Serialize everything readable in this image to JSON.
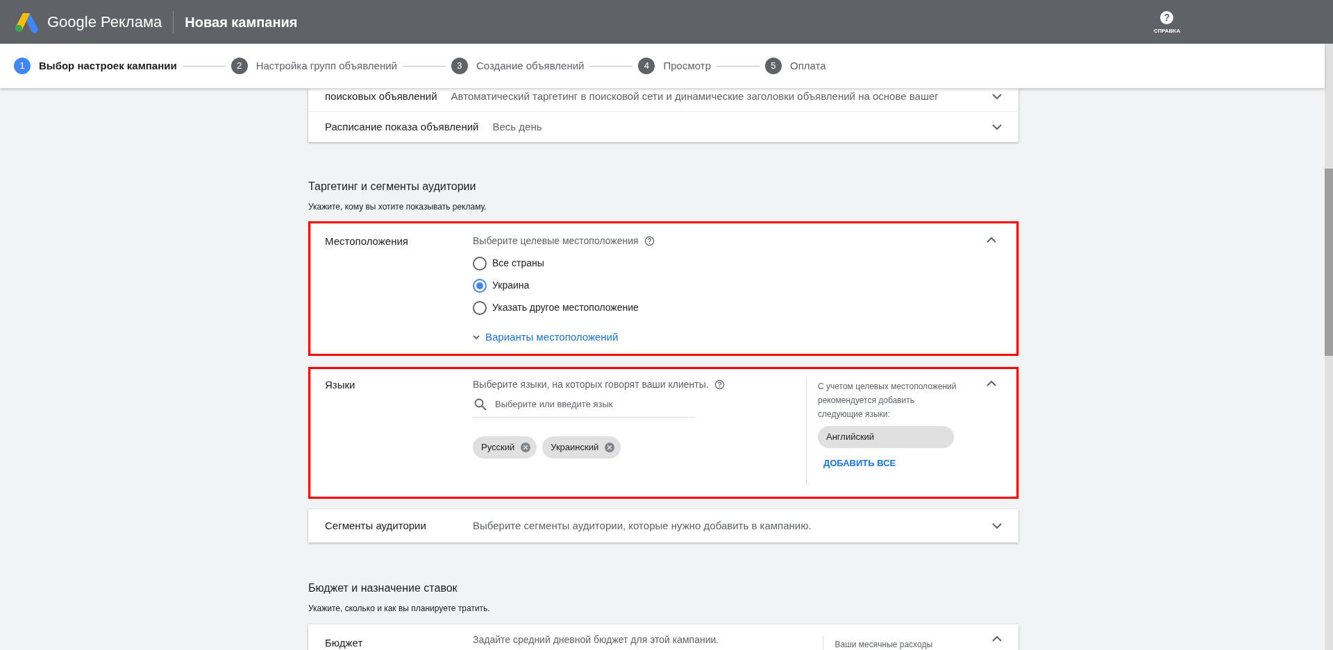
{
  "header": {
    "product": "Google Реклама",
    "title": "Новая кампания",
    "help": {
      "icon": "?",
      "label": "СПРАВКА"
    }
  },
  "steps": [
    {
      "number": "1",
      "label": "Выбор настроек кампании",
      "selected": true
    },
    {
      "number": "2",
      "label": "Настройка групп объявлений",
      "selected": false
    },
    {
      "number": "3",
      "label": "Создание объявлений",
      "selected": false
    },
    {
      "number": "4",
      "label": "Просмотр",
      "selected": false
    },
    {
      "number": "5",
      "label": "Оплата",
      "selected": false
    }
  ],
  "top_card": {
    "rows": [
      {
        "label": "поисковых объявлений",
        "value": "Автоматический таргетинг в поисковой сети и динамические заголовки объявлений на основе вашег"
      },
      {
        "label": "Расписание показа объявлений",
        "value": "Весь день"
      }
    ]
  },
  "targeting": {
    "title": "Таргетинг и сегменты аудитории",
    "subtitle": "Укажите, кому вы хотите показывать рекламу.",
    "locations": {
      "label": "Местоположения",
      "prompt": "Выберите целевые местоположения",
      "highlighted": true,
      "options": [
        {
          "label": "Все страны",
          "selected": false
        },
        {
          "label": "Украина",
          "selected": true
        },
        {
          "label": "Указать другое местоположение",
          "selected": false
        }
      ],
      "link": "Варианты местоположений"
    },
    "languages": {
      "label": "Языки",
      "prompt": "Выберите языки, на которых говорят ваши клиенты.",
      "highlighted": true,
      "search_placeholder": "Выберите или введите язык",
      "chips": [
        "Русский",
        "Украинский"
      ],
      "recommendation": "С учетом целевых местоположений рекомендуется добавить следующие языки:",
      "suggested": [
        "Английский"
      ],
      "add_all": "ДОБАВИТЬ ВСЕ"
    },
    "audience": {
      "label": "Сегменты аудитории",
      "value": "Выберите сегменты аудитории, которые нужно добавить в кампанию."
    }
  },
  "budget": {
    "title": "Бюджет и назначение ставок",
    "subtitle": "Укажите, сколько и как вы планируете тратить.",
    "card": {
      "label": "Бюджет",
      "prompt": "Задайте средний дневной бюджет для этой кампании.",
      "side": "Ваши месячные расходы"
    }
  }
}
